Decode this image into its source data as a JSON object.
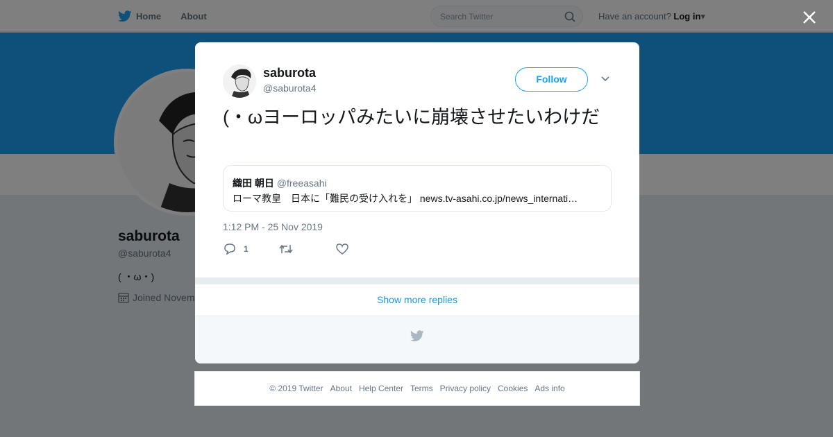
{
  "nav": {
    "home_label": "Home",
    "about_label": "About",
    "search_placeholder": "Search Twitter",
    "account_prompt": "Have an account?",
    "login_label": "Log in"
  },
  "profile": {
    "name": "saburota",
    "handle": "@saburota4",
    "bio": "( ・ω・)",
    "joined": "Joined Novem"
  },
  "tweet": {
    "author_name": "saburota",
    "author_handle": "@saburota4",
    "follow_label": "Follow",
    "text": "(・ωヨーロッパみたいに崩壊させたいわけだ",
    "quote": {
      "author_name": "織田 朝日",
      "author_handle": "@freeasahi",
      "text": "ローマ教皇　日本に「難民の受け入れを」 news.tv-asahi.co.jp/news_internati…"
    },
    "timestamp": "1:12 PM - 25 Nov 2019",
    "reply_count": "1"
  },
  "show_more_label": "Show more replies",
  "footer": {
    "copyright": "© 2019 Twitter",
    "links": [
      "About",
      "Help Center",
      "Terms",
      "Privacy policy",
      "Cookies",
      "Ads info"
    ]
  },
  "colors": {
    "accent": "#1da1f2",
    "link": "#1b95e0",
    "secondary_text": "#657786"
  },
  "icons": [
    "twitter-bird-icon",
    "search-icon",
    "caret-down-icon",
    "close-icon",
    "reply-icon",
    "retweet-icon",
    "like-icon",
    "calendar-icon"
  ]
}
